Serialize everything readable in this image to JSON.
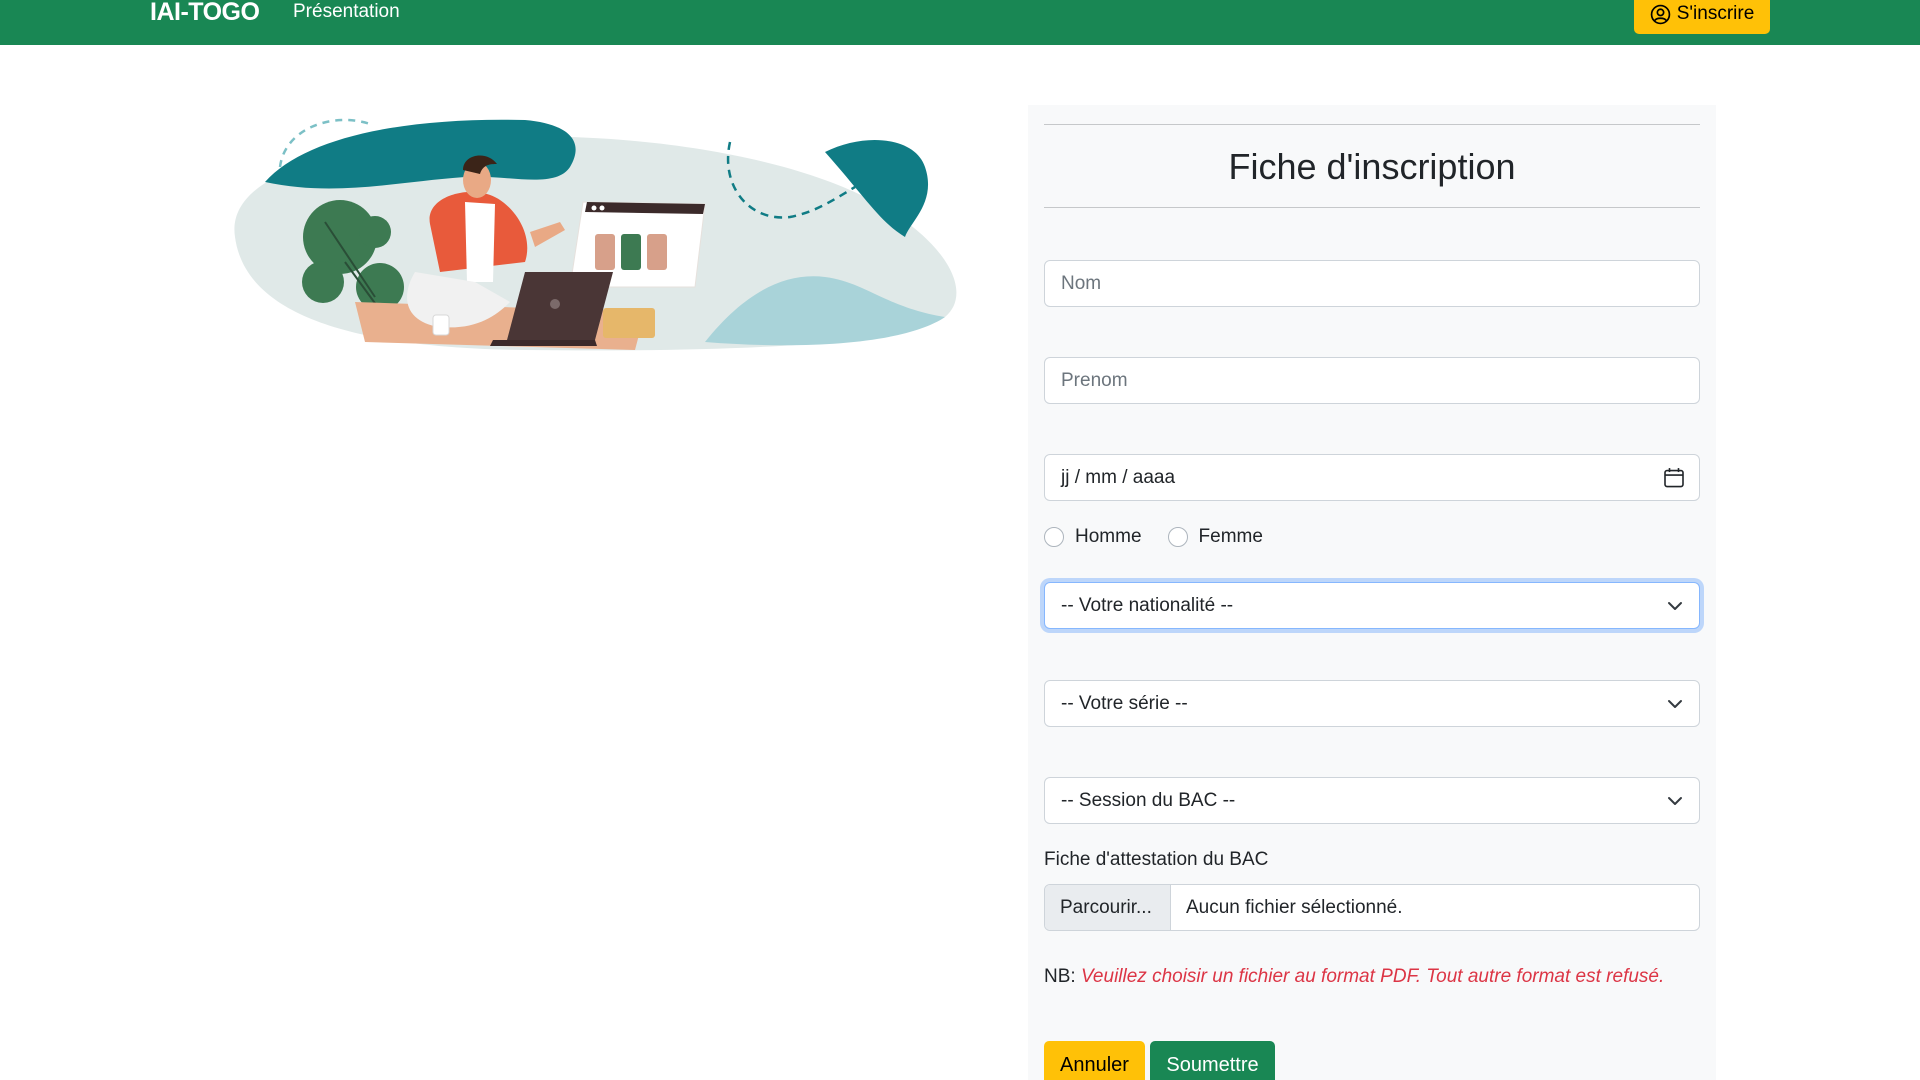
{
  "navbar": {
    "brand": "IAI-TOGO",
    "presentation_link": "Présentation",
    "signup_label": "S'inscrire",
    "background": "#198754",
    "accent": "#ffc107"
  },
  "form": {
    "title": "Fiche d'inscription",
    "nom_placeholder": "Nom",
    "prenom_placeholder": "Prenom",
    "date_placeholder": "jj / mm / aaaa",
    "gender_options": [
      "Homme",
      "Femme"
    ],
    "nationality_select": "-- Votre nationalité --",
    "serie_select": "-- Votre série --",
    "session_select": "-- Session du BAC --",
    "file_label": "Fiche d'attestation du BAC",
    "file_button": "Parcourir...",
    "file_status": "Aucun fichier sélectionné.",
    "nb_prefix": "NB:",
    "nb_warning": "Veuillez choisir un fichier au format PDF. Tout autre format est refusé.",
    "cancel_label": "Annuler",
    "submit_label": "Soumettre"
  },
  "icons": {
    "signup": "user-circle-icon",
    "date": "calendar-icon",
    "select": "chevron-down-icon"
  }
}
